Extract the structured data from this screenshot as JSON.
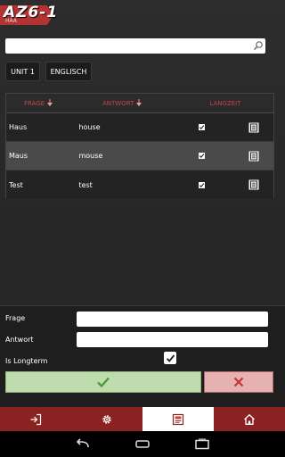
{
  "app": {
    "logo": "AZ6-1",
    "logo_subtitle": "HAA"
  },
  "search": {
    "value": "",
    "placeholder": ""
  },
  "filters": {
    "unit_label": "UNIT 1",
    "language_label": "ENGLISCH"
  },
  "table": {
    "columns": {
      "frage": "FRAGE",
      "antwort": "ANTWORT",
      "langzeit": "LANGZEIT"
    },
    "rows": [
      {
        "frage": "Haus",
        "antwort": "house",
        "langzeit": true
      },
      {
        "frage": "Maus",
        "antwort": "mouse",
        "langzeit": true
      },
      {
        "frage": "Test",
        "antwort": "test",
        "langzeit": true
      }
    ]
  },
  "form": {
    "frage_label": "Frage",
    "frage_value": "",
    "antwort_label": "Antwort",
    "antwort_value": "",
    "longterm_label": "Is Longterm",
    "longterm_checked": true
  },
  "tabs": [
    {
      "icon": "logout-icon"
    },
    {
      "icon": "settings-icon"
    },
    {
      "icon": "vocabulary-icon",
      "active": true
    },
    {
      "icon": "home-icon"
    }
  ],
  "colors": {
    "accent_red": "#8b2222",
    "header_red": "#c64545",
    "ok_green": "#bfdcae",
    "cancel_red": "#e6b1b1"
  }
}
